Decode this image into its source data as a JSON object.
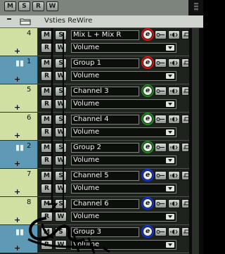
{
  "toolbar": {
    "buttons": [
      "M",
      "S",
      "R",
      "W"
    ]
  },
  "header": {
    "title": "Vsties ReWire"
  },
  "track_buttons": {
    "mute": "M",
    "solo": "S",
    "read": "R",
    "write": "W",
    "edit": "e"
  },
  "tracks": [
    {
      "number": "4",
      "name": "Mix L + Mix R",
      "automation": "Volume",
      "kind": "audio",
      "edit_highlight": "red"
    },
    {
      "number": "1",
      "name": "Group 1",
      "automation": "Volume",
      "kind": "group",
      "edit_highlight": "red"
    },
    {
      "number": "5",
      "name": "Channel 3",
      "automation": "Volume",
      "kind": "audio",
      "edit_highlight": "green"
    },
    {
      "number": "6",
      "name": "Channel 4",
      "automation": "Volume",
      "kind": "audio",
      "edit_highlight": "green"
    },
    {
      "number": "2",
      "name": "Group 2",
      "automation": "Volume",
      "kind": "group",
      "edit_highlight": "green"
    },
    {
      "number": "7",
      "name": "Channel 5",
      "automation": "Volume",
      "kind": "audio",
      "edit_highlight": "blue"
    },
    {
      "number": "8",
      "name": "Channel 6",
      "automation": "Volume",
      "kind": "audio",
      "edit_highlight": "blue"
    },
    {
      "number": "",
      "name": "Group 3",
      "automation": "Volume",
      "kind": "group",
      "edit_highlight": "blue"
    }
  ],
  "colors": {
    "audio_track": "#cfe0a2",
    "group_track": "#5e9ab6",
    "highlight_red": "#e01010",
    "highlight_green": "#1c8a1c",
    "highlight_blue": "#1030d8"
  },
  "icons": {
    "folder": "folder-icon",
    "collapse": "minus-icon",
    "expand": "plus-icon",
    "group_track": "group-icon",
    "input_monitor": "monitor-icon",
    "insert": "speaker-icon",
    "send": "send-icon",
    "dropdown": "chevron-down-icon"
  }
}
